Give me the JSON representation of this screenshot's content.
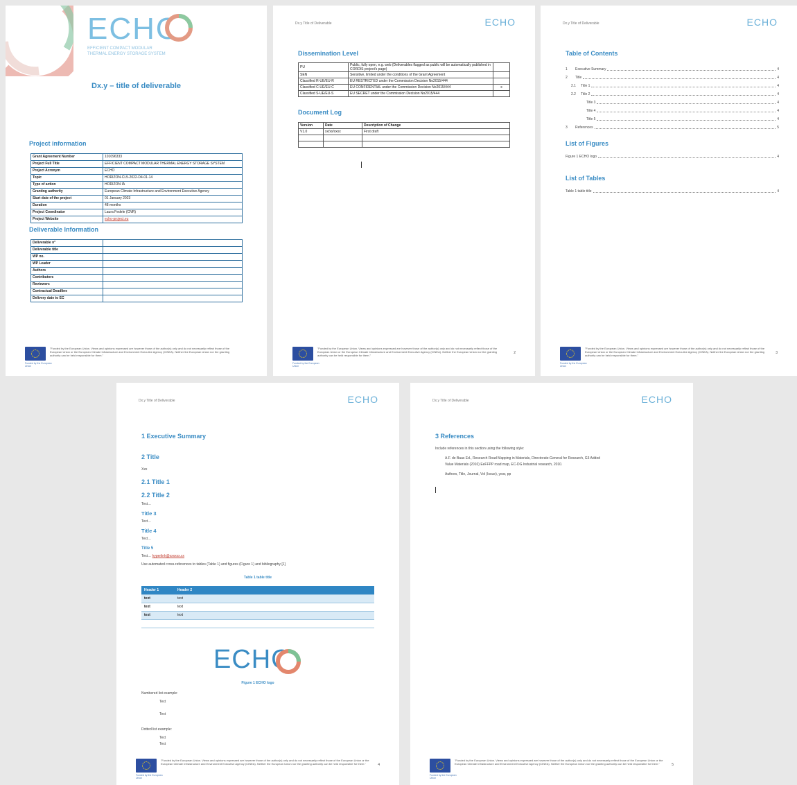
{
  "cover": {
    "logo": "ECHO",
    "logo_sub1": "EFFICIENT COMPACT MODULAR",
    "logo_sub2": "THERMAL ENERGY STORAGE SYSTEM",
    "title": "Dx.y – title of deliverable",
    "project_heading": "Project information",
    "project_rows": [
      {
        "k": "Grant Agreement Number",
        "v": "101096333"
      },
      {
        "k": "Project Full Title",
        "v": "EFFICIENT COMPACT MODULAR THERMAL ENERGY STORAGE SYSTEM"
      },
      {
        "k": "Project Acronym",
        "v": "ECHO"
      },
      {
        "k": "Topic",
        "v": "HORIZON-CL5-2022-D4-01-14"
      },
      {
        "k": "Type of action",
        "v": "HORIZON IA"
      },
      {
        "k": "Granting authority",
        "v": "European Climate Infrastructure and Environment Executive Agency"
      },
      {
        "k": "Start date of the project",
        "v": "01 January 2023"
      },
      {
        "k": "Duration",
        "v": "48 months"
      },
      {
        "k": "Project Coordinator",
        "v": "Laura Fedele (CNR)"
      },
      {
        "k": "Project Website",
        "v": "echo-project.eu"
      }
    ],
    "deliverable_heading": "Deliverable Information",
    "deliverable_rows": [
      "Deliverable n°",
      "Deliverable title",
      "WP no.",
      "WP Leader",
      "Authors",
      "Contributors",
      "Reviewers",
      "Contractual Deadline",
      "Delivery date to EC"
    ]
  },
  "footer": {
    "funded": "Funded by the European Union",
    "text": "\"Funded by the European Union. Views and opinions expressed are however those of the author(s) only and do not necessarily reflect those of the European Union or the European Climate Infrastructure and Environment Executive Agency (CINEA). Neither the European Union nor the granting authority can be held responsible for them.\""
  },
  "running_header": "Dx.y Title of Deliverable",
  "header_logo": "ECHO",
  "page2": {
    "diss_heading": "Dissemination Level",
    "diss_rows": [
      {
        "k": "PU",
        "v": "Public, fully open, e.g. web (Deliverables flagged as public will be automatically published in CORDIS project's page)",
        "x": ""
      },
      {
        "k": "SEN",
        "v": "Sensitive, limited under the conditions of the Grant Agreement",
        "x": ""
      },
      {
        "k": "Classified R-UE/EU-R",
        "v": "EU RESTRICTED under the Commission Decision No2015/444",
        "x": ""
      },
      {
        "k": "Classified C-UE/EU-C",
        "v": "EU CONFIDENTIAL under the Commission Decision No2015/444",
        "x": "x"
      },
      {
        "k": "Classified S-UE/EU-S",
        "v": "EU SECRET under the Commission Decision No2015/444",
        "x": ""
      }
    ],
    "log_heading": "Document Log",
    "log_header": [
      "Version",
      "Date",
      "Description of Change"
    ],
    "log_rows": [
      [
        "V1.0",
        "xx/xx/xxxx",
        "First draft"
      ],
      [
        "",
        "",
        ""
      ],
      [
        "",
        "",
        ""
      ]
    ],
    "page_num": "2"
  },
  "page3": {
    "toc_heading": "Table of Contents",
    "toc": [
      {
        "n": "1",
        "t": "Executive Summary",
        "p": "4"
      },
      {
        "n": "2",
        "t": "Title",
        "p": "4"
      },
      {
        "n": "2.1",
        "t": "Title 1",
        "p": "4"
      },
      {
        "n": "2.2",
        "t": "Title 2",
        "p": "4"
      },
      {
        "n": "",
        "t": "Title 3",
        "p": "4"
      },
      {
        "n": "",
        "t": "Title 4",
        "p": "4"
      },
      {
        "n": "",
        "t": "Title 5",
        "p": "4"
      },
      {
        "n": "3",
        "t": "References",
        "p": "5"
      }
    ],
    "fig_heading": "List of Figures",
    "fig_item": {
      "t": "Figure 1 ECHO logo",
      "p": "4"
    },
    "tab_heading": "List of Tables",
    "tab_item": {
      "t": "Table 1 table title",
      "p": "4"
    },
    "page_num": "3"
  },
  "page4": {
    "s1": "1   Executive Summary",
    "s2": "2   Title",
    "xxx": "Xxx",
    "t1": "2.1   Title 1",
    "t2": "2.2   Title 2",
    "text": "Text…",
    "t3": "Title 3",
    "t4": "Title 4",
    "t5": "Title 5",
    "hyperlink_prefix": "Text… ",
    "hyperlink": "hyperlink@xxxxxx.xx",
    "crossref": "Use automated cross-references to tables (Table 1) and figures (Figure 1) and bibliography [1]",
    "table_caption": "Table 1 table title",
    "table_header": [
      "Header 1",
      "Header 2",
      ""
    ],
    "table_rows": [
      [
        "text",
        "text",
        ""
      ],
      [
        "text",
        "text",
        ""
      ],
      [
        "text",
        "text",
        ""
      ],
      [
        "",
        "",
        ""
      ]
    ],
    "logo": "ECHO",
    "fig_caption": "Figure 1 ECHO logo",
    "numbered_label": "Numbered list example:",
    "numbered_items": [
      "Text",
      "Text"
    ],
    "dotted_label": "Dotted list example:",
    "dotted_items": [
      "Text",
      "Text"
    ],
    "page_num": "4"
  },
  "page5": {
    "heading": "3   References",
    "intro": "Include references in this section using the following style:",
    "ref1a": "A.F. de Baas Ed., Research Road Mapping in Materials, Directorate-General for Research, G3 Added",
    "ref1b": "Value Materials (2010) EeFFPP road map, EC-DG Industrial research, 2010.",
    "ref2": "Authors, Title, Journal, Vol (Issue), year, pp",
    "page_num": "5"
  },
  "colors": {
    "accent": "#3a8cc4",
    "table_header": "#2f86c4",
    "logo_blue": "#6ab0d8",
    "logo_ring": "#e08a7a"
  }
}
